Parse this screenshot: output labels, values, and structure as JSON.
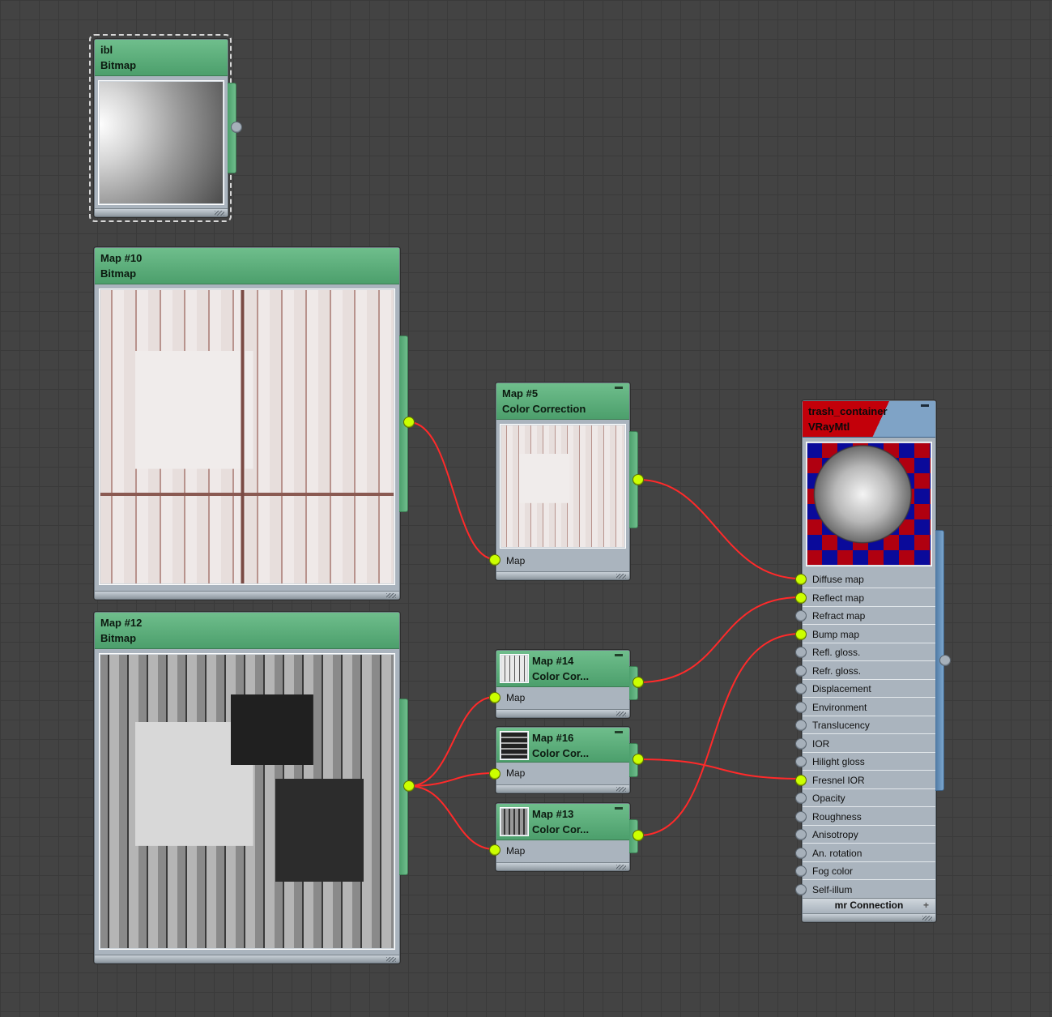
{
  "colors": {
    "accent_green": "#5aad79",
    "wire": "#ff2a2a",
    "socket_active": "#ccff00",
    "material_header": "#c3000a",
    "material_tab": "#6b97c3"
  },
  "nodes": {
    "ibl": {
      "name": "ibl",
      "type": "Bitmap"
    },
    "map10": {
      "name": "Map #10",
      "type": "Bitmap"
    },
    "map12": {
      "name": "Map #12",
      "type": "Bitmap"
    },
    "map5": {
      "name": "Map #5",
      "type": "Color Correction",
      "slot": "Map"
    },
    "map14": {
      "name": "Map #14",
      "type": "Color Cor...",
      "slot": "Map"
    },
    "map16": {
      "name": "Map #16",
      "type": "Color Cor...",
      "slot": "Map"
    },
    "map13": {
      "name": "Map #13",
      "type": "Color Cor...",
      "slot": "Map"
    },
    "material": {
      "name": "trash_container",
      "type": "VRayMtl",
      "footer": "mr Connection",
      "slots": [
        {
          "label": "Diffuse map",
          "connected": true
        },
        {
          "label": "Reflect map",
          "connected": true
        },
        {
          "label": "Refract map",
          "connected": false
        },
        {
          "label": "Bump map",
          "connected": true
        },
        {
          "label": "Refl. gloss.",
          "connected": false
        },
        {
          "label": "Refr. gloss.",
          "connected": false
        },
        {
          "label": "Displacement",
          "connected": false
        },
        {
          "label": "Environment",
          "connected": false
        },
        {
          "label": "Translucency",
          "connected": false
        },
        {
          "label": "IOR",
          "connected": false
        },
        {
          "label": "Hilight gloss",
          "connected": false
        },
        {
          "label": "Fresnel IOR",
          "connected": true
        },
        {
          "label": "Opacity",
          "connected": false
        },
        {
          "label": "Roughness",
          "connected": false
        },
        {
          "label": "Anisotropy",
          "connected": false
        },
        {
          "label": "An. rotation",
          "connected": false
        },
        {
          "label": "Fog color",
          "connected": false
        },
        {
          "label": "Self-illum",
          "connected": false
        }
      ]
    }
  }
}
